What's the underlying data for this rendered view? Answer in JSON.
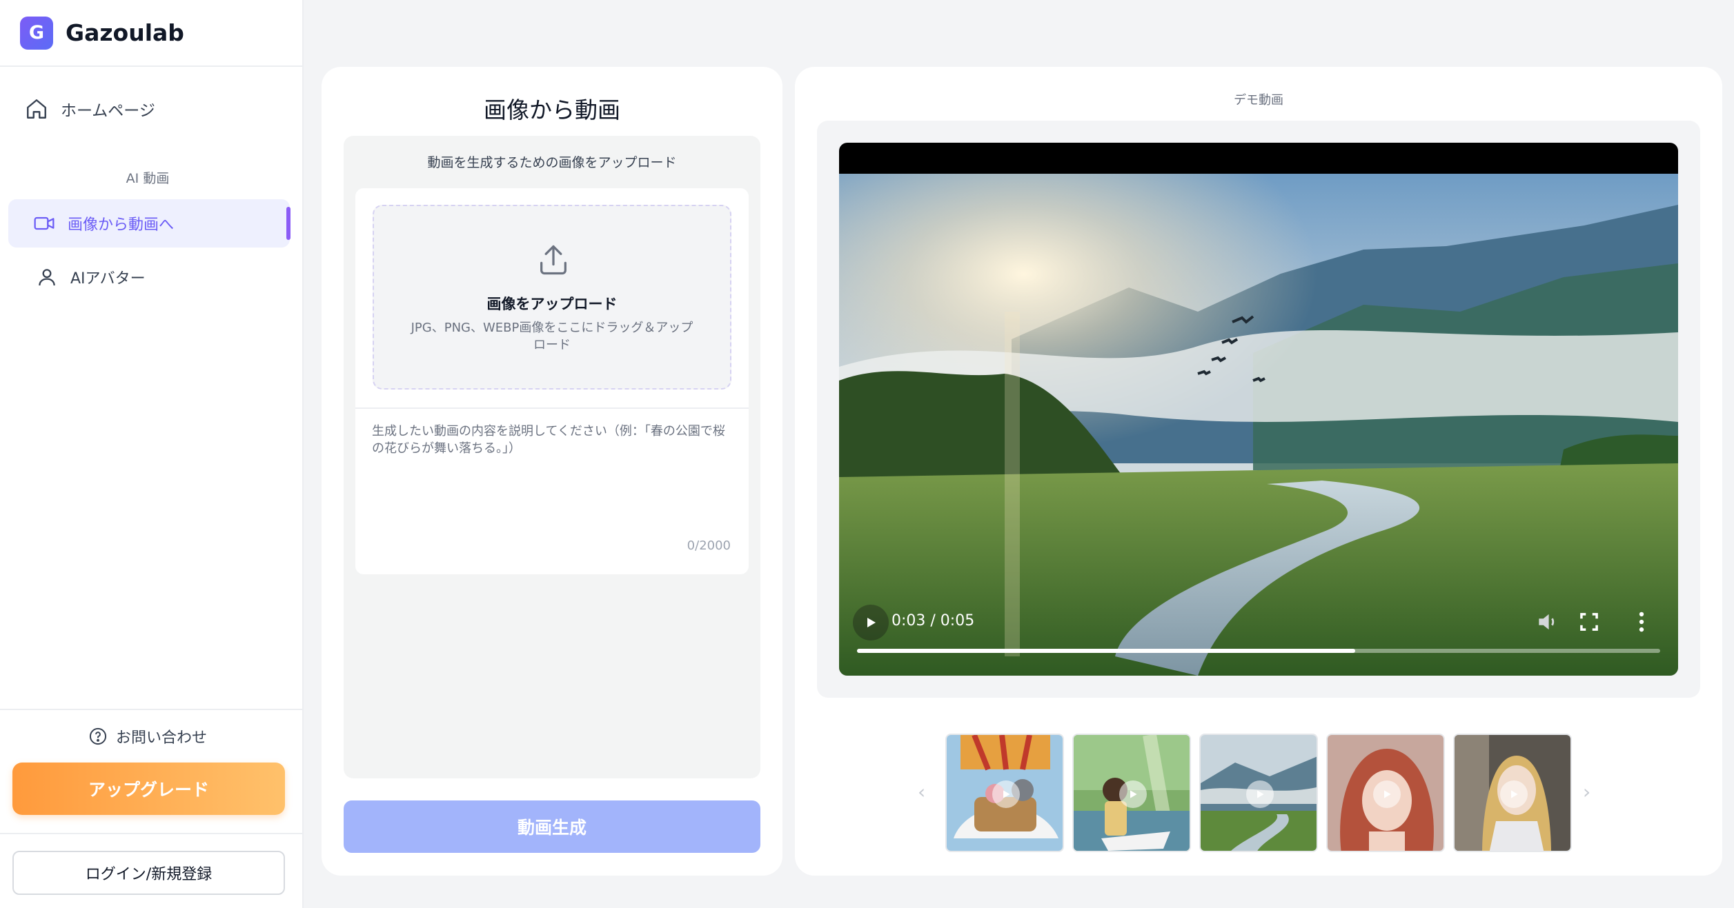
{
  "brand": {
    "logo_letter": "G",
    "name": "Gazoulab"
  },
  "sidebar": {
    "home_label": "ホームページ",
    "section_label": "AI 動画",
    "items": [
      {
        "label": "画像から動画へ",
        "icon": "video-icon",
        "active": true
      },
      {
        "label": "AIアバター",
        "icon": "user-icon",
        "active": false
      }
    ],
    "contact_label": "お問い合わせ",
    "upgrade_label": "アップグレード",
    "login_label": "ログイン/新規登録"
  },
  "form": {
    "title": "画像から動画",
    "subtitle": "動画を生成するための画像をアップロード",
    "upload_title": "画像をアップロード",
    "upload_hint": "JPG、PNG、WEBP画像をここにドラッグ＆アップロード",
    "prompt_placeholder": "生成したい動画の内容を説明してください（例：「春の公園で桜の花びらが舞い落ちる。」）",
    "counter": "0/2000",
    "generate_label": "動画生成"
  },
  "demo": {
    "label": "デモ動画",
    "video": {
      "time": "0:03 / 0:05",
      "progress": 0.62
    },
    "thumbnails": [
      {
        "name": "thumb-balloon"
      },
      {
        "name": "thumb-girl-boat"
      },
      {
        "name": "thumb-river-valley"
      },
      {
        "name": "thumb-red-hair-girl"
      },
      {
        "name": "thumb-blond-man"
      }
    ]
  },
  "colors": {
    "accent": "#6b5cf6",
    "upgrade": "#ff9a3c",
    "generate_disabled": "#a2b4fb"
  }
}
